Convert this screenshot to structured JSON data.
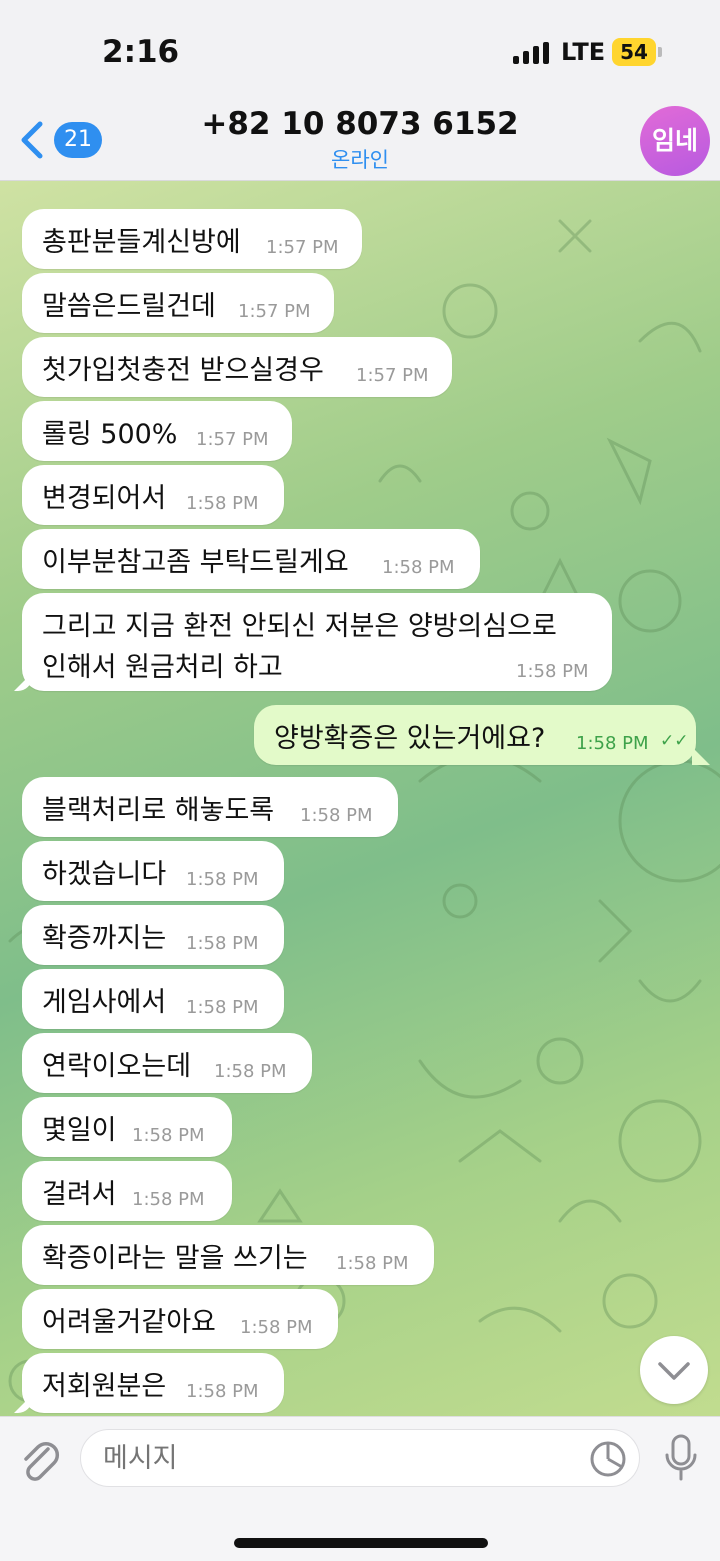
{
  "status_bar": {
    "time": "2:16",
    "network": "LTE",
    "battery": "54"
  },
  "header": {
    "back_badge": "21",
    "title": "+82 10 8073 6152",
    "subtitle": "온라인",
    "avatar_initials": "임네",
    "avatar_color": "#c863dd"
  },
  "messages": [
    {
      "text": "총판분들계신방에",
      "time": "1:57 PM",
      "dir": "in"
    },
    {
      "text": "말씀은드릴건데",
      "time": "1:57 PM",
      "dir": "in"
    },
    {
      "text": "첫가입첫충전 받으실경우",
      "time": "1:57 PM",
      "dir": "in"
    },
    {
      "text": "롤링 500%",
      "time": "1:57 PM",
      "dir": "in"
    },
    {
      "text": "변경되어서",
      "time": "1:58 PM",
      "dir": "in"
    },
    {
      "text": "이부분참고좀 부탁드릴게요",
      "time": "1:58 PM",
      "dir": "in"
    },
    {
      "text_line1": "그리고 지금 환전 안되신 저분은 양방의심으로",
      "text_line2": "인해서 원금처리 하고",
      "time": "1:58 PM",
      "dir": "in"
    },
    {
      "text": "양방확증은 있는거에요?",
      "time": "1:58 PM",
      "dir": "out",
      "read": "✓✓"
    },
    {
      "text": "블랙처리로 해놓도록",
      "time": "1:58 PM",
      "dir": "in"
    },
    {
      "text": "하겠습니다",
      "time": "1:58 PM",
      "dir": "in"
    },
    {
      "text": "확증까지는",
      "time": "1:58 PM",
      "dir": "in"
    },
    {
      "text": "게임사에서",
      "time": "1:58 PM",
      "dir": "in"
    },
    {
      "text": "연락이오는데",
      "time": "1:58 PM",
      "dir": "in"
    },
    {
      "text": "몇일이",
      "time": "1:58 PM",
      "dir": "in"
    },
    {
      "text": "걸려서",
      "time": "1:58 PM",
      "dir": "in"
    },
    {
      "text": "확증이라는 말을 쓰기는",
      "time": "1:58 PM",
      "dir": "in"
    },
    {
      "text": "어려울거같아요",
      "time": "1:58 PM",
      "dir": "in"
    },
    {
      "text": "저회원분은",
      "time": "1:58 PM",
      "dir": "in"
    }
  ],
  "input": {
    "placeholder": "메시지"
  },
  "icons": {
    "back": "chevron-left-icon",
    "attach": "paperclip-icon",
    "sticker": "sticker-icon",
    "mic": "microphone-icon",
    "scroll": "chevron-down-icon",
    "read": "double-check-icon"
  },
  "colors": {
    "accent": "#2f8ff0",
    "outgoing_bubble": "#e3fac9",
    "read_check": "#3ea24a"
  }
}
